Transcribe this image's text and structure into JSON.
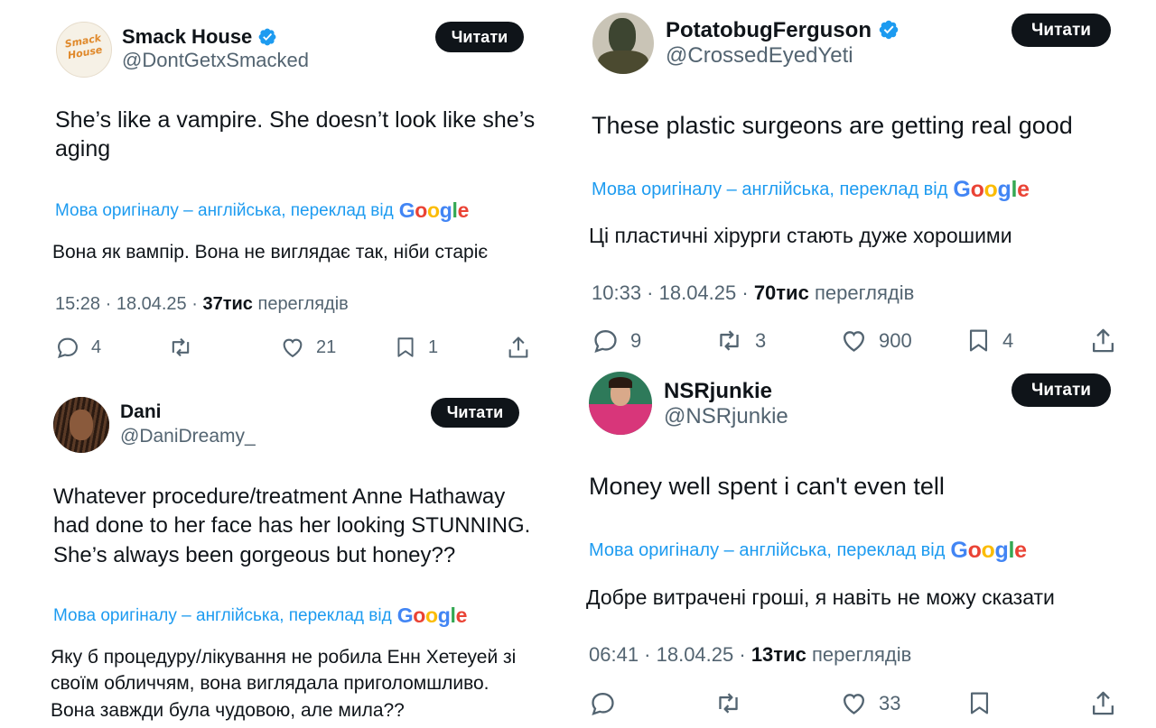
{
  "colors": {
    "text": "#0f1419",
    "secondary": "#536471",
    "link": "#1d9bf0",
    "button_bg": "#0f1419",
    "verified": "#1d9bf0",
    "google_blue": "#4285F4",
    "google_red": "#EA4335",
    "google_yellow": "#FBBC05",
    "google_green": "#34A853"
  },
  "tweets": [
    {
      "name": "Smack House",
      "handle": "@DontGetxSmacked",
      "verified": true,
      "follow": "Читати",
      "text": "She’s like a vampire. She doesn’t look like she’s aging",
      "translate_prefix": "Мова оригіналу – англійська, переклад від",
      "translated": "Вона як вампір. Вона не виглядає так, ніби старіє",
      "time": "15:28 · 18.04.25 ·",
      "views": "37тис",
      "views_label": "переглядів",
      "replies": "4",
      "retweets": "",
      "likes": "21",
      "bookmarks": "1",
      "avatar_text": "Smack House"
    },
    {
      "name": "Dani",
      "handle": "@DaniDreamy_",
      "verified": false,
      "follow": "Читати",
      "text": "Whatever procedure/treatment Anne Hathaway had done to her face has her looking STUNNING. She’s always been gorgeous but honey??",
      "translate_prefix": "Мова оригіналу – англійська, переклад від",
      "translated": "Яку б процедуру/лікування не робила Енн Хетеуей зі своїм обличчям, вона виглядала приголомшливо. Вона завжди була чудовою, але мила??"
    },
    {
      "name": "PotatobugFerguson",
      "handle": "@CrossedEyedYeti",
      "verified": true,
      "follow": "Читати",
      "text": "These plastic surgeons are getting real good",
      "translate_prefix": "Мова оригіналу – англійська, переклад від",
      "translated": "Ці пластичні хірурги стають дуже хорошими",
      "time": "10:33 · 18.04.25 ·",
      "views": "70тис",
      "views_label": "переглядів",
      "replies": "9",
      "retweets": "3",
      "likes": "900",
      "bookmarks": "4"
    },
    {
      "name": "NSRjunkie",
      "handle": "@NSRjunkie",
      "verified": false,
      "follow": "Читати",
      "text": "Money well spent i can't even tell",
      "translate_prefix": "Мова оригіналу – англійська, переклад від",
      "translated": "Добре витрачені гроші, я навіть не можу сказати",
      "time": "06:41 · 18.04.25 ·",
      "views": "13тис",
      "views_label": "переглядів",
      "replies": "",
      "retweets": "",
      "likes": "33",
      "bookmarks": ""
    }
  ],
  "icons": [
    "reply-icon",
    "retweet-icon",
    "like-icon",
    "bookmark-icon",
    "share-icon",
    "verified-badge-icon",
    "google-logo"
  ]
}
